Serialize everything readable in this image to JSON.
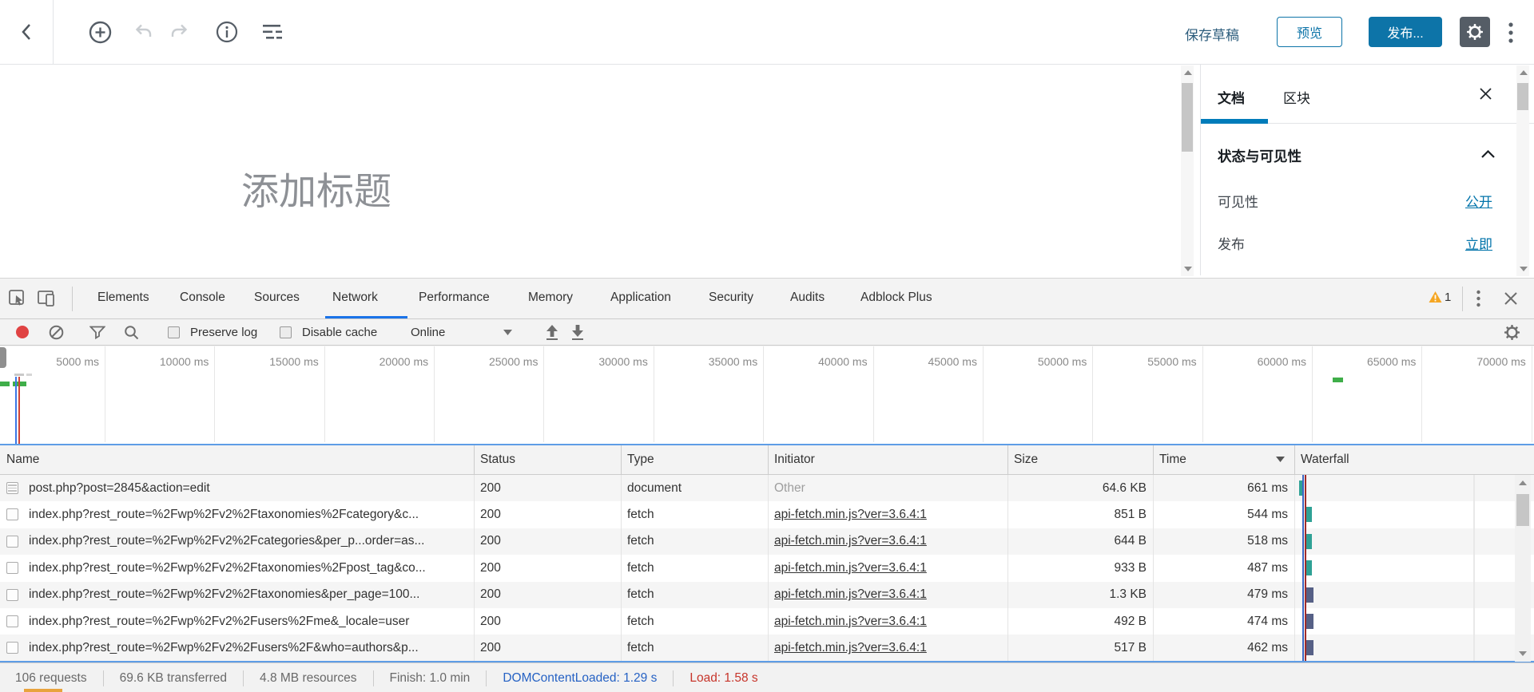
{
  "editor": {
    "title_placeholder": "添加标题",
    "toolbar": {
      "save_draft": "保存草稿",
      "preview": "预览",
      "publish": "发布..."
    },
    "sidebar": {
      "tabs": [
        "文档",
        "区块"
      ],
      "panel_title": "状态与可见性",
      "rows": [
        {
          "label": "可见性",
          "value": "公开"
        },
        {
          "label": "发布",
          "value": "立即"
        }
      ]
    }
  },
  "devtools": {
    "tabs": [
      "Elements",
      "Console",
      "Sources",
      "Network",
      "Performance",
      "Memory",
      "Application",
      "Security",
      "Audits",
      "Adblock Plus"
    ],
    "active_tab": "Network",
    "warning_count": "1",
    "toolbar": {
      "preserve_log": "Preserve log",
      "disable_cache": "Disable cache",
      "throttling": "Online"
    },
    "ruler_ticks": [
      "5000 ms",
      "10000 ms",
      "15000 ms",
      "20000 ms",
      "25000 ms",
      "30000 ms",
      "35000 ms",
      "40000 ms",
      "45000 ms",
      "50000 ms",
      "55000 ms",
      "60000 ms",
      "65000 ms",
      "70000 ms"
    ],
    "grid": {
      "columns": [
        "Name",
        "Status",
        "Type",
        "Initiator",
        "Size",
        "Time",
        "Waterfall"
      ],
      "sorted_column": "Time",
      "rows": [
        {
          "name": "post.php?post=2845&action=edit",
          "status": "200",
          "type": "document",
          "initiator": "Other",
          "initiator_is_link": false,
          "size": "64.6 KB",
          "time": "661 ms",
          "waterfall_bar": "teal-left"
        },
        {
          "name": "index.php?rest_route=%2Fwp%2Fv2%2Ftaxonomies%2Fcategory&c...",
          "status": "200",
          "type": "fetch",
          "initiator": "api-fetch.min.js?ver=3.6.4:1",
          "initiator_is_link": true,
          "size": "851 B",
          "time": "544 ms",
          "waterfall_bar": "teal"
        },
        {
          "name": "index.php?rest_route=%2Fwp%2Fv2%2Fcategories&per_p...order=as...",
          "status": "200",
          "type": "fetch",
          "initiator": "api-fetch.min.js?ver=3.6.4:1",
          "initiator_is_link": true,
          "size": "644 B",
          "time": "518 ms",
          "waterfall_bar": "teal"
        },
        {
          "name": "index.php?rest_route=%2Fwp%2Fv2%2Ftaxonomies%2Fpost_tag&co...",
          "status": "200",
          "type": "fetch",
          "initiator": "api-fetch.min.js?ver=3.6.4:1",
          "initiator_is_link": true,
          "size": "933 B",
          "time": "487 ms",
          "waterfall_bar": "teal"
        },
        {
          "name": "index.php?rest_route=%2Fwp%2Fv2%2Ftaxonomies&per_page=100...",
          "status": "200",
          "type": "fetch",
          "initiator": "api-fetch.min.js?ver=3.6.4:1",
          "initiator_is_link": true,
          "size": "1.3 KB",
          "time": "479 ms",
          "waterfall_bar": "slate"
        },
        {
          "name": "index.php?rest_route=%2Fwp%2Fv2%2Fusers%2Fme&_locale=user",
          "status": "200",
          "type": "fetch",
          "initiator": "api-fetch.min.js?ver=3.6.4:1",
          "initiator_is_link": true,
          "size": "492 B",
          "time": "474 ms",
          "waterfall_bar": "slate"
        },
        {
          "name": "index.php?rest_route=%2Fwp%2Fv2%2Fusers%2F&who=authors&p...",
          "status": "200",
          "type": "fetch",
          "initiator": "api-fetch.min.js?ver=3.6.4:1",
          "initiator_is_link": true,
          "size": "517 B",
          "time": "462 ms",
          "waterfall_bar": "slate"
        }
      ]
    },
    "status_bar": [
      {
        "text": "106 requests",
        "color": "gray"
      },
      {
        "text": "69.6 KB transferred",
        "color": "gray"
      },
      {
        "text": "4.8 MB resources",
        "color": "gray"
      },
      {
        "text": "Finish: 1.0 min",
        "color": "gray"
      },
      {
        "text": "DOMContentLoaded: 1.29 s",
        "color": "blue"
      },
      {
        "text": "Load: 1.58 s",
        "color": "red"
      }
    ],
    "colors": {
      "accent_blue": "#1a73e8",
      "record_red": "#e04343",
      "warning_yellow": "#f5a623",
      "waterfall_teal": "#2fa195",
      "waterfall_slate": "#566086",
      "wp_blue": "#0d74a8"
    }
  }
}
